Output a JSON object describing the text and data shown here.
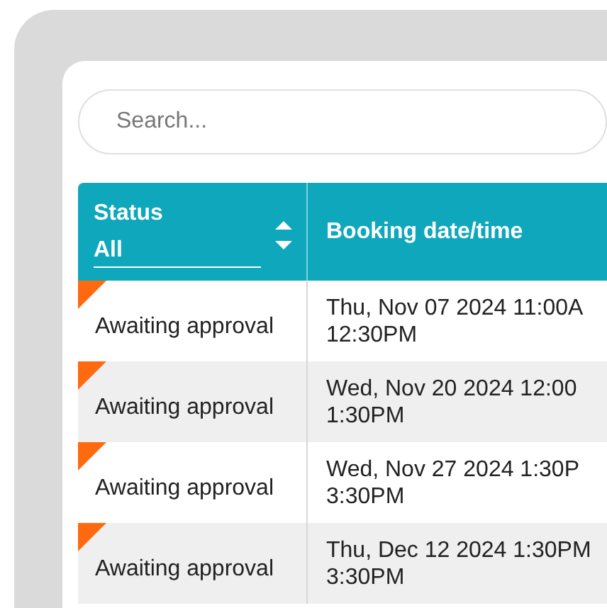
{
  "search": {
    "placeholder": "Search..."
  },
  "table": {
    "columns": [
      {
        "label": "Status",
        "filter": "All",
        "sortable": true
      },
      {
        "label": "Booking date/time"
      }
    ],
    "rows": [
      {
        "status": "Awaiting approval",
        "flagged": true,
        "date": "Thu, Nov 07 2024 11:00A",
        "end": "12:30PM"
      },
      {
        "status": "Awaiting approval",
        "flagged": true,
        "date": "Wed, Nov 20 2024 12:00",
        "end": "1:30PM"
      },
      {
        "status": "Awaiting approval",
        "flagged": true,
        "date": "Wed, Nov 27 2024 1:30P",
        "end": "3:30PM"
      },
      {
        "status": "Awaiting approval",
        "flagged": true,
        "date": "Thu, Dec 12 2024 1:30PM",
        "end": "3:30PM"
      }
    ]
  }
}
